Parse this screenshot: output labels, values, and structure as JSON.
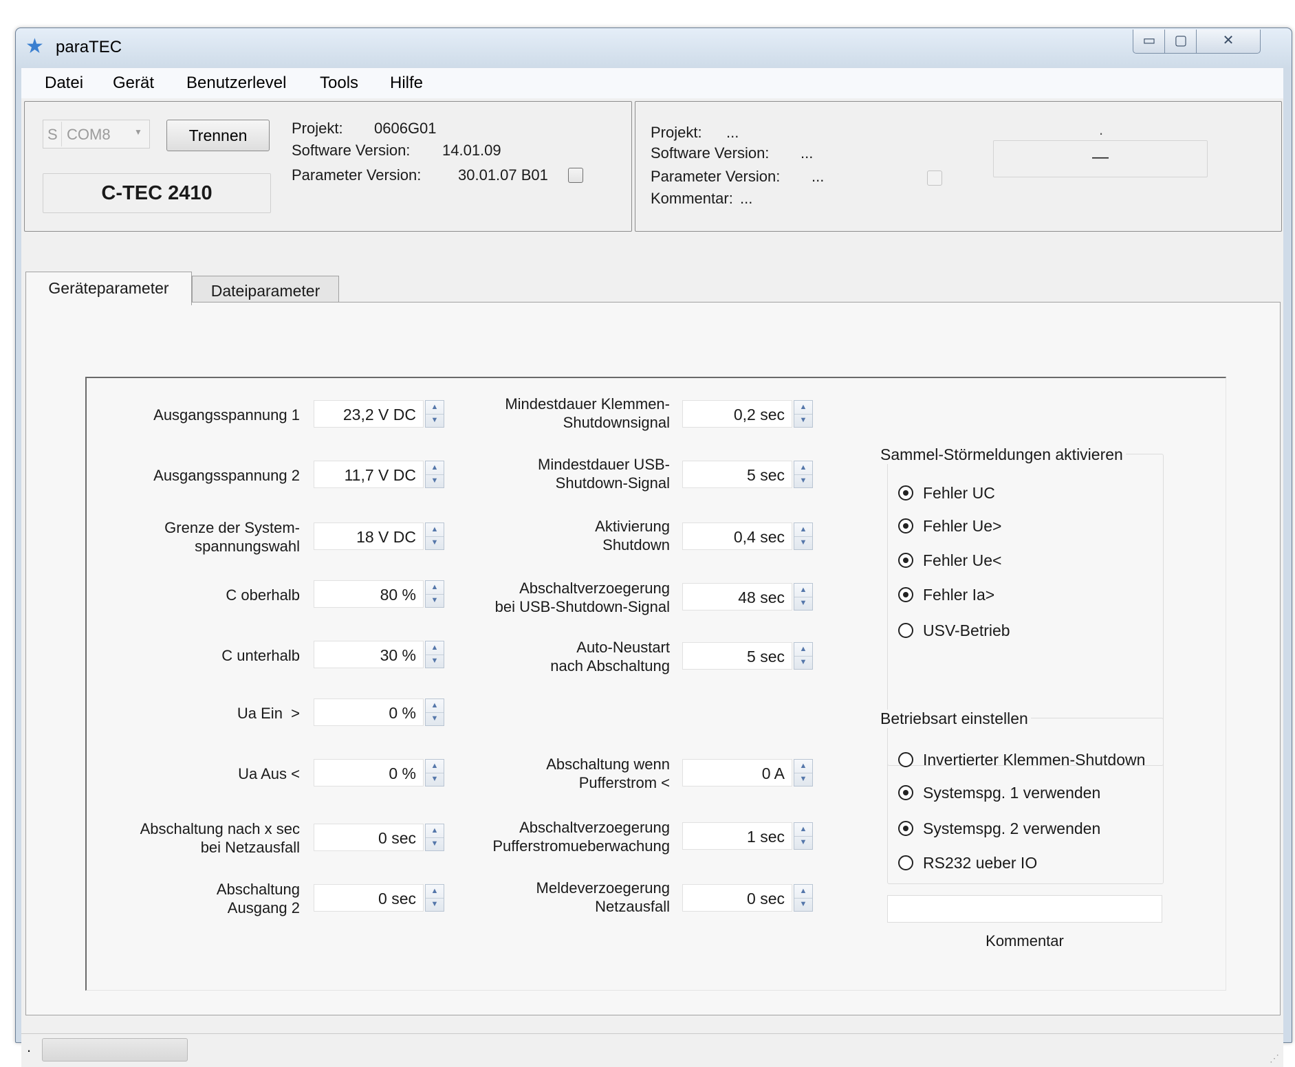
{
  "window": {
    "title": "paraTEC",
    "minimize_glyph": "▭",
    "maximize_glyph": "▢",
    "close_glyph": "✕"
  },
  "menu": [
    "Datei",
    "Gerät",
    "Benutzerlevel",
    "Tools",
    "Hilfe"
  ],
  "connection": {
    "port_prefix": "S",
    "port": "COM8",
    "disconnect_label": "Trennen",
    "device_name": "C-TEC 2410"
  },
  "device_info": {
    "project_label": "Projekt:",
    "project_value": "0606G01",
    "software_label": "Software Version:",
    "software_value": "14.01.09",
    "parameter_label": "Parameter Version:",
    "parameter_value": "30.01.07 B01"
  },
  "file_info": {
    "project_label": "Projekt:",
    "project_value": "...",
    "software_label": "Software Version:",
    "software_value": "...",
    "parameter_label": "Parameter Version:",
    "parameter_value": "...",
    "comment_label": "Kommentar:",
    "comment_value": "...",
    "dot": ".",
    "status_value": "—"
  },
  "tabs": [
    "Geräteparameter",
    "Dateiparameter"
  ],
  "left_params": [
    {
      "label": "Ausgangsspannung 1",
      "value": "23,2 V DC"
    },
    {
      "label": "Ausgangsspannung 2",
      "value": "11,7 V DC"
    },
    {
      "label": "Grenze der System-\nspannungswahl",
      "value": "18 V DC"
    },
    {
      "label": "C oberhalb",
      "value": "80 %"
    },
    {
      "label": "C unterhalb",
      "value": "30 %"
    },
    {
      "label": "Ua Ein  >",
      "value": "0 %"
    },
    {
      "label": "Ua Aus <",
      "value": "0 %"
    },
    {
      "label": "Abschaltung nach x sec\nbei Netzausfall",
      "value": "0 sec"
    },
    {
      "label": "Abschaltung\nAusgang 2",
      "value": "0 sec"
    }
  ],
  "middle_params": [
    {
      "label": "Mindestdauer Klemmen-\nShutdownsignal",
      "value": "0,2 sec"
    },
    {
      "label": "Mindestdauer USB-\nShutdown-Signal",
      "value": "5 sec"
    },
    {
      "label": "Aktivierung\nShutdown",
      "value": "0,4 sec"
    },
    {
      "label": "Abschaltverzoegerung\nbei USB-Shutdown-Signal",
      "value": "48 sec"
    },
    {
      "label": "Auto-Neustart\nnach Abschaltung",
      "value": "5 sec"
    },
    {
      "label": "Abschaltung wenn\nPufferstrom <",
      "value": "0 A"
    },
    {
      "label": "Abschaltverzoegerung\nPufferstromueberwachung",
      "value": "1 sec"
    },
    {
      "label": "Meldeverzoegerung\nNetzausfall",
      "value": "0 sec"
    }
  ],
  "fault_group": {
    "title": "Sammel-Störmeldungen aktivieren",
    "items": [
      {
        "label": "Fehler UC",
        "checked": true
      },
      {
        "label": "Fehler Ue>",
        "checked": true
      },
      {
        "label": "Fehler Ue<",
        "checked": true
      },
      {
        "label": "Fehler Ia>",
        "checked": true
      },
      {
        "label": "USV-Betrieb",
        "checked": false
      }
    ]
  },
  "mode_group": {
    "title": "Betriebsart einstellen",
    "items": [
      {
        "label": "Invertierter Klemmen-Shutdown",
        "checked": false
      },
      {
        "label": "Systemspg. 1 verwenden",
        "checked": true
      },
      {
        "label": "Systemspg. 2 verwenden",
        "checked": true
      },
      {
        "label": "RS232 ueber IO",
        "checked": false
      }
    ]
  },
  "comment": {
    "label": "Kommentar",
    "value": ""
  },
  "statusbar": {
    "dot": ".",
    "progress": 0
  }
}
